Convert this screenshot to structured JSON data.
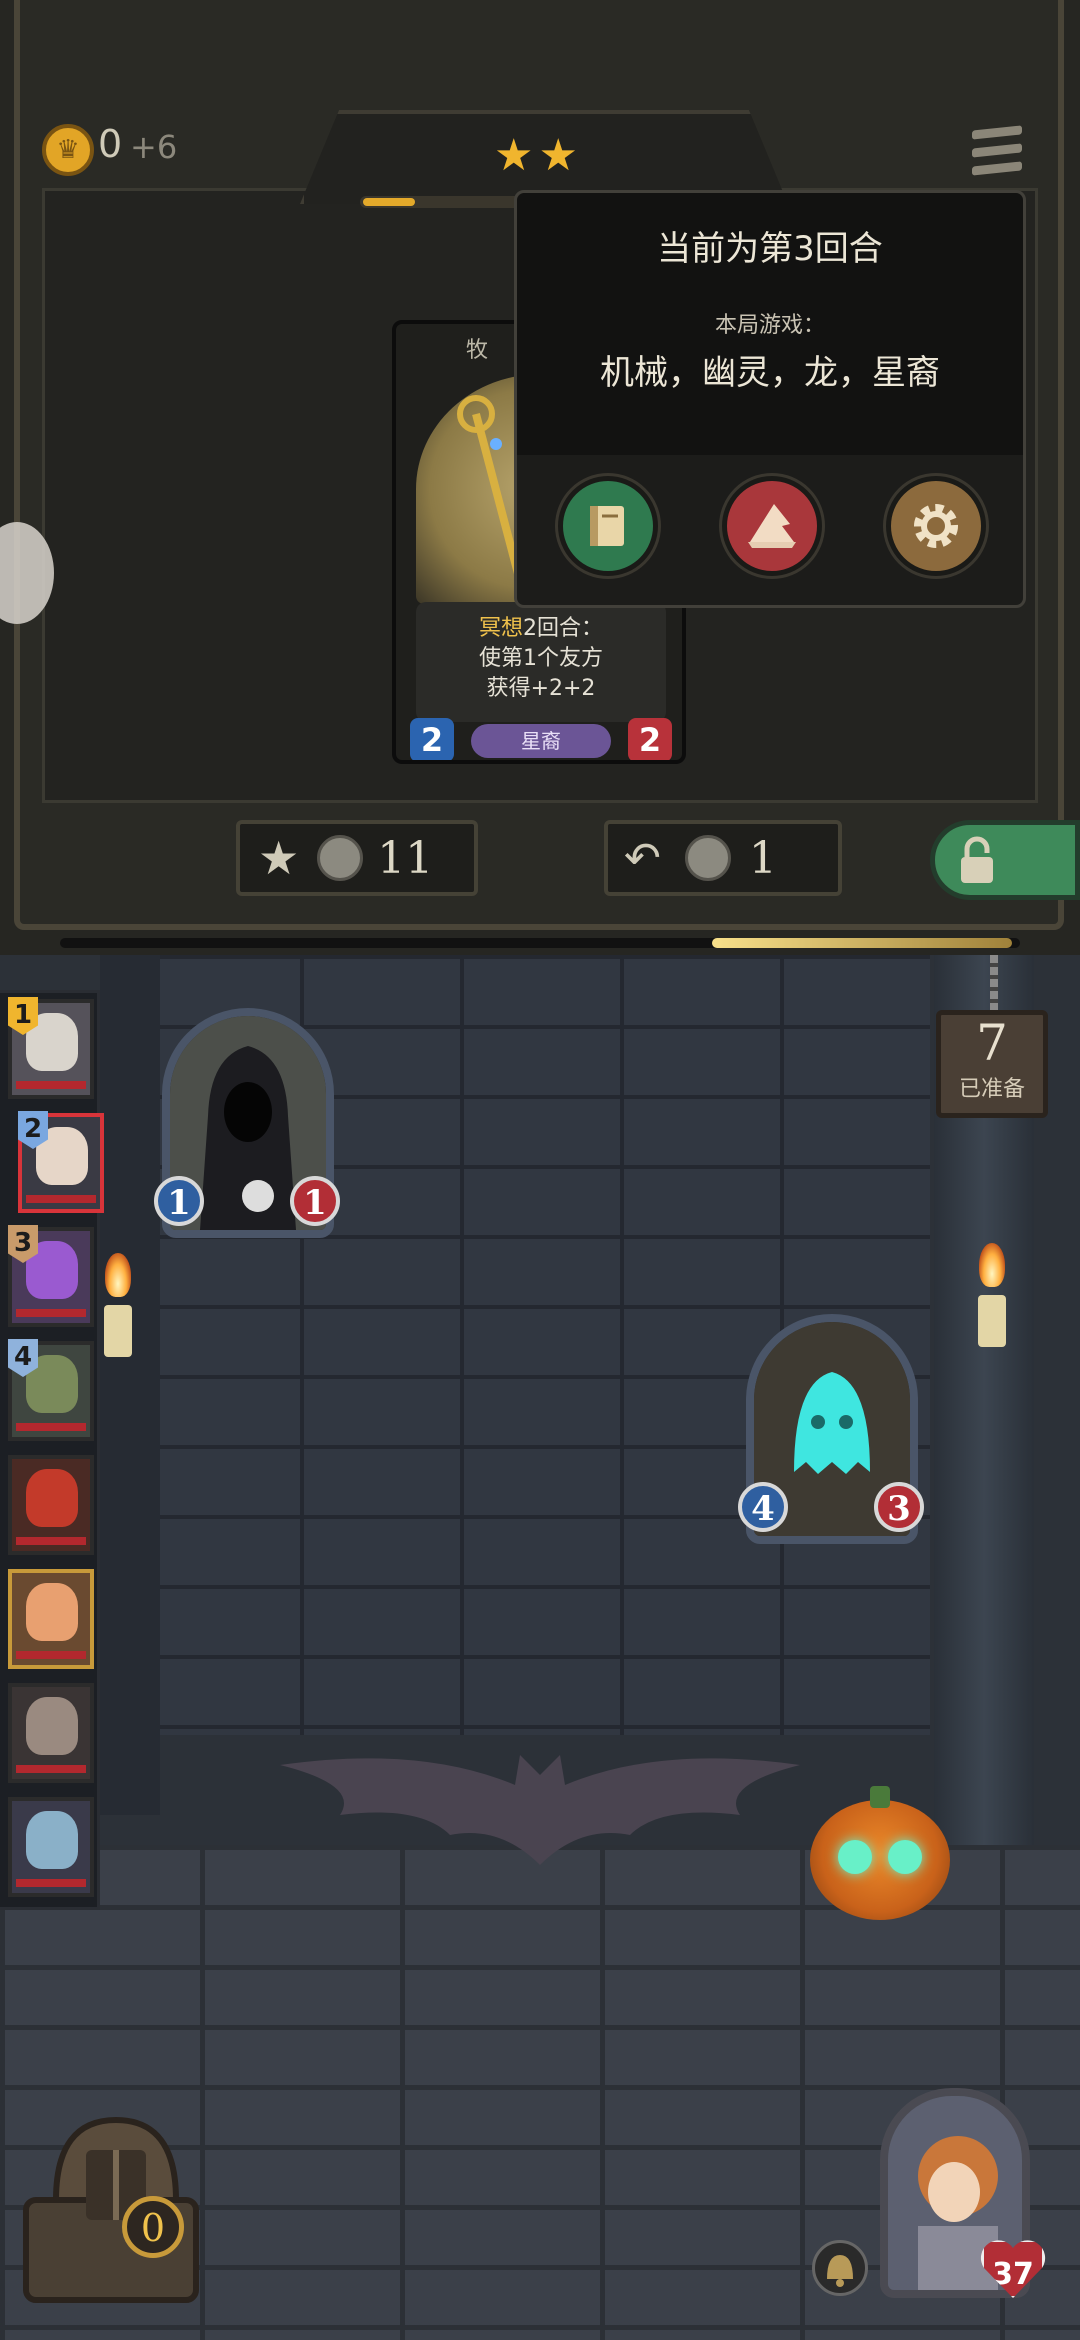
{
  "header": {
    "gold": "0",
    "gold_income": "+6",
    "tier_stars": 2,
    "tier_progress": 0.16
  },
  "card": {
    "name_fragment": "牧",
    "desc_keyword": "冥想",
    "desc_line1_rest": "2回合：",
    "desc_line2": "使第1个友方",
    "desc_line3": "获得+2+2",
    "tribe": "星裔",
    "attack": "2",
    "health": "2"
  },
  "popup": {
    "round_text": "当前为第3回合",
    "game_label": "本局游戏：",
    "tribes": "机械，幽灵，龙，星裔",
    "buttons": [
      "book-icon",
      "wizard-hat-icon",
      "gear-icon"
    ],
    "colors": {
      "book": "#2f7a4f",
      "hat": "#a9373b",
      "gear": "#8c6a3d"
    }
  },
  "shop_actions": {
    "upgrade_cost": "11",
    "refresh_cost": "1",
    "lock_icon": "lock-icon"
  },
  "board": {
    "timer": "7",
    "timer_label": "已准备",
    "minions": [
      {
        "attack": "1",
        "health": "1"
      },
      {
        "attack": "4",
        "health": "3"
      }
    ]
  },
  "heroes": [
    {
      "tier": "1",
      "tier_color": "#f0b52e",
      "face": "#d9d4cc",
      "bg": "#55525a",
      "highlight": false
    },
    {
      "tier": "2",
      "tier_color": "#7aa7e0",
      "face": "#e6d6c8",
      "bg": "#3a3a44",
      "highlight": true
    },
    {
      "tier": "3",
      "tier_color": "#c99b6a",
      "face": "#9a5ad0",
      "bg": "#4a3a5a",
      "highlight": false
    },
    {
      "tier": "4",
      "tier_color": "#8fb2dc",
      "face": "#7a8a5a",
      "bg": "#3f4640",
      "highlight": false
    },
    {
      "tier": "",
      "tier_color": "",
      "face": "#c33a2a",
      "bg": "#4a2a24",
      "highlight": false
    },
    {
      "tier": "",
      "tier_color": "",
      "face": "#e8a070",
      "bg": "#6a4a30",
      "highlight": false,
      "gold": true
    },
    {
      "tier": "",
      "tier_color": "",
      "face": "#9a8a80",
      "bg": "#3a3434",
      "highlight": false
    },
    {
      "tier": "",
      "tier_color": "",
      "face": "#8ab0c8",
      "bg": "#3a3a4a",
      "highlight": false
    }
  ],
  "bottom": {
    "chest_count": "0",
    "player_health": "37"
  }
}
